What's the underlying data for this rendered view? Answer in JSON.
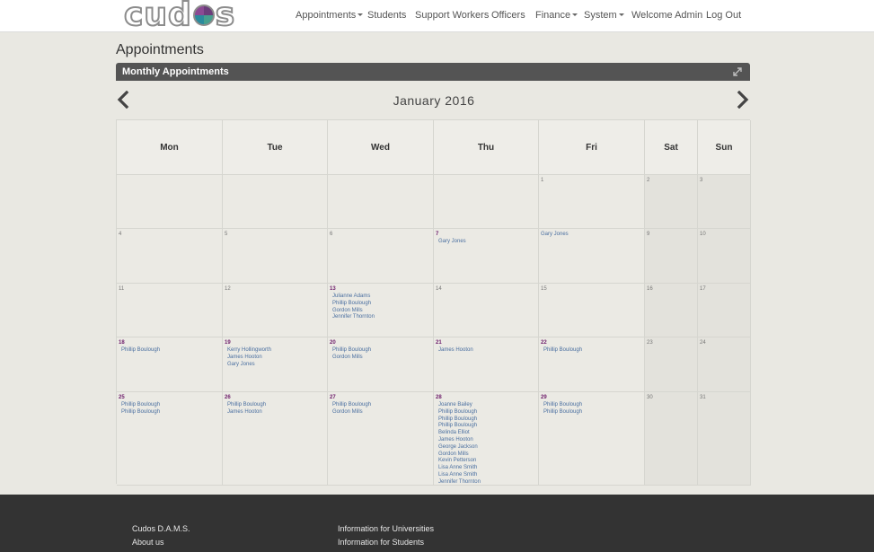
{
  "brand": {
    "logo_text_left": "cud",
    "logo_text_right": "s"
  },
  "nav": {
    "items": [
      {
        "label": "Appointments",
        "dropdown": true
      },
      {
        "label": "Students",
        "dropdown": false
      },
      {
        "label": "Support Workers",
        "dropdown": false
      },
      {
        "label": "Officers",
        "dropdown": false
      },
      {
        "label": "Finance",
        "dropdown": true
      },
      {
        "label": "System",
        "dropdown": true
      },
      {
        "label": "Welcome Admin",
        "dropdown": false
      },
      {
        "label": "Log Out",
        "dropdown": false
      }
    ]
  },
  "page": {
    "title": "Appointments"
  },
  "panel": {
    "title": "Monthly Appointments"
  },
  "calendar": {
    "month": "January 2016",
    "weekdays": [
      "Mon",
      "Tue",
      "Wed",
      "Thu",
      "Fri",
      "Sat",
      "Sun"
    ],
    "weeks": [
      [
        {
          "day": "",
          "appts": []
        },
        {
          "day": "",
          "appts": []
        },
        {
          "day": "",
          "appts": []
        },
        {
          "day": "",
          "appts": []
        },
        {
          "day": "1",
          "appts": []
        },
        {
          "day": "2",
          "appts": []
        },
        {
          "day": "3",
          "appts": []
        }
      ],
      [
        {
          "day": "4",
          "appts": []
        },
        {
          "day": "5",
          "appts": []
        },
        {
          "day": "6",
          "appts": []
        },
        {
          "day": "7",
          "appts": [
            "Gary Jones"
          ]
        },
        {
          "day": "8",
          "appts": [
            "Gary Jones"
          ],
          "inline": true
        },
        {
          "day": "9",
          "appts": []
        },
        {
          "day": "10",
          "appts": []
        }
      ],
      [
        {
          "day": "11",
          "appts": []
        },
        {
          "day": "12",
          "appts": []
        },
        {
          "day": "13",
          "appts": [
            "Julianne Adams",
            "Phillip Boulough",
            "Gordon Mills",
            "Jennifer Thornton"
          ]
        },
        {
          "day": "14",
          "appts": []
        },
        {
          "day": "15",
          "appts": []
        },
        {
          "day": "16",
          "appts": []
        },
        {
          "day": "17",
          "appts": []
        }
      ],
      [
        {
          "day": "18",
          "appts": [
            "Phillip Boulough"
          ]
        },
        {
          "day": "19",
          "appts": [
            "Kerry Hollingworth",
            "James Hooton",
            "Gary Jones"
          ]
        },
        {
          "day": "20",
          "appts": [
            "Phillip Boulough",
            "Gordon Mills"
          ]
        },
        {
          "day": "21",
          "appts": [
            "James Hooton"
          ]
        },
        {
          "day": "22",
          "appts": [
            "Phillip Boulough"
          ]
        },
        {
          "day": "23",
          "appts": []
        },
        {
          "day": "24",
          "appts": []
        }
      ],
      [
        {
          "day": "25",
          "appts": [
            "Phillip Boulough",
            "Phillip Boulough"
          ]
        },
        {
          "day": "26",
          "appts": [
            "Phillip Boulough",
            "James Hooton"
          ]
        },
        {
          "day": "27",
          "appts": [
            "Phillip Boulough",
            "Gordon Mills"
          ]
        },
        {
          "day": "28",
          "appts": [
            "Joanne Bailey",
            "Phillip Boulough",
            "Phillip Boulough",
            "Phillip Boulough",
            "Belinda Elliot",
            "James Hooton",
            "George Jackson",
            "Gordon Mills",
            "Kevin Petterson",
            "Lisa Anne Smith",
            "Lisa Anne Smith",
            "Jennifer Thornton"
          ]
        },
        {
          "day": "29",
          "appts": [
            "Phillip Boulough",
            "Phillip Boulough"
          ]
        },
        {
          "day": "30",
          "appts": []
        },
        {
          "day": "31",
          "appts": []
        }
      ]
    ]
  },
  "footer": {
    "links": [
      "Cudos D.A.M.S.",
      "About us",
      "Information for Universities",
      "Information for Students"
    ]
  },
  "colors": {
    "nav_bg": "#ffffff",
    "panel_header": "#545454",
    "appt_link": "#4a6fa0",
    "day_accent": "#6d1b6a",
    "footer_bg": "#333333"
  }
}
